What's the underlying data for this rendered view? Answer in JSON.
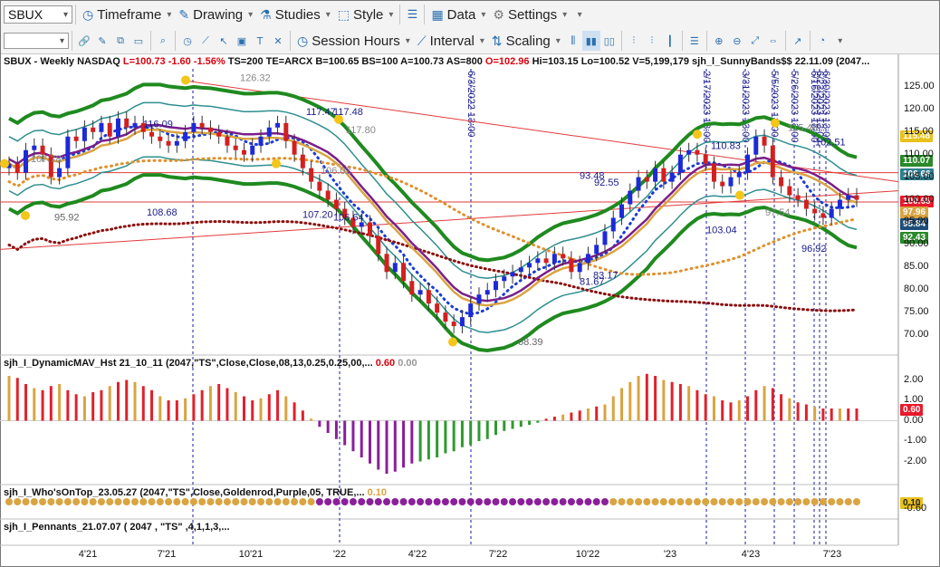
{
  "toolbar": {
    "symbol": "SBUX",
    "timeframe": "Timeframe",
    "drawing": "Drawing",
    "studies": "Studies",
    "style": "Style",
    "data": "Data",
    "settings": "Settings",
    "session_hours": "Session Hours",
    "interval": "Interval",
    "scaling": "Scaling"
  },
  "panels": {
    "price_title": "SBUX - Weekly  NASDAQ",
    "price_stats_red": "L=100.73  -1.60  -1.56%",
    "price_stats": "TS=200  TE=ARCX  B=100.65  BS=100  A=100.73  AS=800",
    "price_o": "O=102.96",
    "price_stats2": "Hi=103.15  Lo=100.52  V=5,199,179  sjh_l_SunnyBands$$  22.11.09 (2047...",
    "dmav_title": "sjh_I_DynamicMAV_Hst 21_10_11 (2047,\"TS\",Close,Close,08,13,0.25,0.25,00,...",
    "dmav_val1": "0.60",
    "dmav_val2": "0.00",
    "who_title": "sjh_I_Who'sOnTop_23.05.27 (2047,\"TS\",Close,Goldenrod,Purple,05,  TRUE,...",
    "who_val": "0.10",
    "pennants_title": "sjh_I_Pennants_21.07.07 ( 2047 , \"TS\" ,4,1,1,3,..."
  },
  "price_tags": [
    {
      "text": "115.48",
      "color": "#e8c21a"
    },
    {
      "text": "110.07",
      "color": "#2a8a2a"
    },
    {
      "text": "106.66",
      "color": "#2f7f8f"
    },
    {
      "text": "100.68",
      "color": "#e8192c"
    },
    {
      "text": "97.96",
      "color": "#d9a441"
    },
    {
      "text": "95.84",
      "color": "#1e4f7a"
    },
    {
      "text": "92.43",
      "color": "#2a8a2a"
    }
  ],
  "indicator_tags": [
    {
      "text": "0.60",
      "color": "#e8192c"
    },
    {
      "text": "0.10",
      "color": "#e8c21a"
    }
  ],
  "annotations": {
    "vlines": [
      "6/3/2022 13:00",
      "2/17/2023 13:00",
      "3/31/2023 13:00",
      "5/5/2023 13:00",
      "5/26/2023 13:00",
      "6/16/2023 13:00",
      "6/23/2023 13:00",
      "6/30/2023 13:00"
    ],
    "labels": [
      {
        "text": "116.09",
        "c": "#1a1a8a"
      },
      {
        "text": "126.32",
        "c": "#888"
      },
      {
        "text": "117.47",
        "c": "#1a1a8a"
      },
      {
        "text": "117.48",
        "c": "#1a1a8a"
      },
      {
        "text": "117.80",
        "c": "#888"
      },
      {
        "text": "107.78",
        "c": "#888"
      },
      {
        "text": "95.92",
        "c": "#666"
      },
      {
        "text": "108.68",
        "c": "#1a1a8a"
      },
      {
        "text": "106.02",
        "c": "#888"
      },
      {
        "text": "107.20",
        "c": "#1a1a8a"
      },
      {
        "text": "106.64",
        "c": "#1a1a8a"
      },
      {
        "text": "93.48",
        "c": "#1a1a8a"
      },
      {
        "text": "92.55",
        "c": "#1a1a8a"
      },
      {
        "text": "83.17",
        "c": "#1a1a8a"
      },
      {
        "text": "81.67",
        "c": "#1a1a8a"
      },
      {
        "text": "68.39",
        "c": "#666"
      },
      {
        "text": "110.83",
        "c": "#1a1a8a"
      },
      {
        "text": "103.04",
        "c": "#1a1a8a"
      },
      {
        "text": "102.51",
        "c": "#1a1a8a"
      },
      {
        "text": "96.92",
        "c": "#1a1a8a"
      },
      {
        "text": "97.54",
        "c": "#888"
      },
      {
        "text": "115.48",
        "c": "#888"
      }
    ]
  },
  "chart_data": {
    "type": "candlestick",
    "title": "SBUX - Weekly  NASDAQ",
    "x_tick_labels": [
      "4'21",
      "7'21",
      "10'21",
      "'22",
      "4'22",
      "7'22",
      "10'22",
      "'23",
      "4'23",
      "7'23"
    ],
    "y_tick_labels": [
      "125.00",
      "120.00",
      "115.00",
      "110.00",
      "105.00",
      "100.00",
      "95.00",
      "90.00",
      "85.00",
      "80.00",
      "75.00",
      "70.00"
    ],
    "ylim": [
      66,
      129
    ],
    "weekly_close": [
      108,
      106,
      111,
      112,
      110,
      105,
      107,
      114,
      113,
      116,
      115,
      117,
      114,
      118,
      116,
      117,
      115,
      114,
      113,
      112,
      113,
      115,
      117,
      116,
      115,
      114,
      112,
      111,
      110,
      112,
      114,
      116,
      117,
      113,
      110,
      107,
      104,
      102,
      100,
      98,
      96,
      94,
      95,
      92,
      88,
      84,
      86,
      82,
      79,
      80,
      77,
      75,
      73,
      72,
      74,
      77,
      79,
      80,
      82,
      83,
      84,
      85,
      86,
      87,
      86,
      88,
      87,
      84,
      86,
      88,
      90,
      93,
      96,
      99,
      102,
      105,
      104,
      107,
      104,
      106,
      110,
      111,
      110,
      108,
      104,
      103,
      105,
      106,
      110,
      114,
      112,
      105,
      103,
      101,
      100,
      98,
      97,
      96,
      98,
      100,
      101,
      100
    ],
    "hist_ylim": [
      -3,
      2.6
    ],
    "hist_ticks": [
      "2.00",
      "1.00",
      "0.00",
      "-1.00",
      "-2.00"
    ],
    "dmav_hist": [
      2.2,
      2.1,
      1.8,
      1.6,
      1.5,
      1.7,
      1.8,
      1.5,
      1.3,
      1.2,
      1.4,
      1.5,
      1.7,
      1.9,
      2.0,
      1.9,
      1.7,
      1.5,
      1.2,
      1.0,
      1.0,
      1.1,
      1.3,
      1.5,
      1.7,
      1.8,
      1.6,
      1.4,
      1.2,
      1.0,
      1.1,
      1.3,
      1.5,
      1.2,
      0.9,
      0.5,
      0.1,
      -0.3,
      -0.6,
      -0.9,
      -1.2,
      -1.5,
      -1.8,
      -2.1,
      -2.4,
      -2.6,
      -2.5,
      -2.3,
      -2.1,
      -2.0,
      -1.9,
      -1.8,
      -1.6,
      -1.5,
      -1.3,
      -1.2,
      -1.0,
      -0.9,
      -0.7,
      -0.5,
      -0.4,
      -0.3,
      -0.2,
      -0.1,
      0.1,
      0.2,
      0.3,
      0.4,
      0.5,
      0.6,
      0.7,
      0.8,
      1.2,
      1.6,
      1.9,
      2.2,
      2.3,
      2.2,
      2.0,
      1.9,
      1.8,
      1.7,
      1.5,
      1.3,
      1.2,
      1.0,
      0.9,
      1.0,
      1.2,
      1.5,
      1.7,
      1.6,
      1.3,
      1.1,
      0.9,
      0.8,
      0.7,
      0.6,
      0.6,
      0.6,
      0.6,
      0.6
    ],
    "who_on_top": [
      "goldenrod",
      "goldenrod",
      "goldenrod",
      "goldenrod",
      "goldenrod",
      "goldenrod",
      "goldenrod",
      "goldenrod",
      "goldenrod",
      "goldenrod",
      "goldenrod",
      "goldenrod",
      "goldenrod",
      "goldenrod",
      "goldenrod",
      "goldenrod",
      "goldenrod",
      "goldenrod",
      "goldenrod",
      "goldenrod",
      "goldenrod",
      "goldenrod",
      "goldenrod",
      "goldenrod",
      "goldenrod",
      "goldenrod",
      "goldenrod",
      "goldenrod",
      "goldenrod",
      "goldenrod",
      "goldenrod",
      "goldenrod",
      "goldenrod",
      "goldenrod",
      "goldenrod",
      "goldenrod",
      "goldenrod",
      "purple",
      "purple",
      "purple",
      "purple",
      "purple",
      "purple",
      "purple",
      "purple",
      "purple",
      "purple",
      "purple",
      "purple",
      "purple",
      "purple",
      "purple",
      "purple",
      "purple",
      "purple",
      "purple",
      "purple",
      "purple",
      "purple",
      "purple",
      "purple",
      "purple",
      "purple",
      "purple",
      "purple",
      "purple",
      "purple",
      "purple",
      "purple",
      "purple",
      "purple",
      "purple",
      "goldenrod",
      "goldenrod",
      "goldenrod",
      "goldenrod",
      "goldenrod",
      "goldenrod",
      "goldenrod",
      "goldenrod",
      "goldenrod",
      "goldenrod",
      "goldenrod",
      "goldenrod",
      "goldenrod",
      "goldenrod",
      "goldenrod",
      "goldenrod",
      "goldenrod",
      "goldenrod",
      "goldenrod",
      "goldenrod",
      "goldenrod",
      "goldenrod",
      "goldenrod",
      "goldenrod",
      "goldenrod",
      "goldenrod",
      "goldenrod",
      "goldenrod",
      "goldenrod",
      "goldenrod"
    ]
  }
}
